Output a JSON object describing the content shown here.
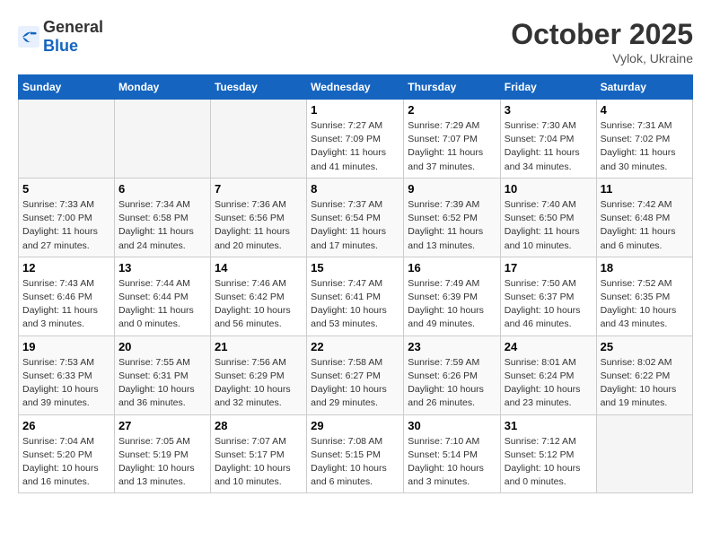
{
  "header": {
    "logo_general": "General",
    "logo_blue": "Blue",
    "month_year": "October 2025",
    "location": "Vylok, Ukraine"
  },
  "days_of_week": [
    "Sunday",
    "Monday",
    "Tuesday",
    "Wednesday",
    "Thursday",
    "Friday",
    "Saturday"
  ],
  "weeks": [
    [
      {
        "day": "",
        "info": ""
      },
      {
        "day": "",
        "info": ""
      },
      {
        "day": "",
        "info": ""
      },
      {
        "day": "1",
        "info": "Sunrise: 7:27 AM\nSunset: 7:09 PM\nDaylight: 11 hours and 41 minutes."
      },
      {
        "day": "2",
        "info": "Sunrise: 7:29 AM\nSunset: 7:07 PM\nDaylight: 11 hours and 37 minutes."
      },
      {
        "day": "3",
        "info": "Sunrise: 7:30 AM\nSunset: 7:04 PM\nDaylight: 11 hours and 34 minutes."
      },
      {
        "day": "4",
        "info": "Sunrise: 7:31 AM\nSunset: 7:02 PM\nDaylight: 11 hours and 30 minutes."
      }
    ],
    [
      {
        "day": "5",
        "info": "Sunrise: 7:33 AM\nSunset: 7:00 PM\nDaylight: 11 hours and 27 minutes."
      },
      {
        "day": "6",
        "info": "Sunrise: 7:34 AM\nSunset: 6:58 PM\nDaylight: 11 hours and 24 minutes."
      },
      {
        "day": "7",
        "info": "Sunrise: 7:36 AM\nSunset: 6:56 PM\nDaylight: 11 hours and 20 minutes."
      },
      {
        "day": "8",
        "info": "Sunrise: 7:37 AM\nSunset: 6:54 PM\nDaylight: 11 hours and 17 minutes."
      },
      {
        "day": "9",
        "info": "Sunrise: 7:39 AM\nSunset: 6:52 PM\nDaylight: 11 hours and 13 minutes."
      },
      {
        "day": "10",
        "info": "Sunrise: 7:40 AM\nSunset: 6:50 PM\nDaylight: 11 hours and 10 minutes."
      },
      {
        "day": "11",
        "info": "Sunrise: 7:42 AM\nSunset: 6:48 PM\nDaylight: 11 hours and 6 minutes."
      }
    ],
    [
      {
        "day": "12",
        "info": "Sunrise: 7:43 AM\nSunset: 6:46 PM\nDaylight: 11 hours and 3 minutes."
      },
      {
        "day": "13",
        "info": "Sunrise: 7:44 AM\nSunset: 6:44 PM\nDaylight: 11 hours and 0 minutes."
      },
      {
        "day": "14",
        "info": "Sunrise: 7:46 AM\nSunset: 6:42 PM\nDaylight: 10 hours and 56 minutes."
      },
      {
        "day": "15",
        "info": "Sunrise: 7:47 AM\nSunset: 6:41 PM\nDaylight: 10 hours and 53 minutes."
      },
      {
        "day": "16",
        "info": "Sunrise: 7:49 AM\nSunset: 6:39 PM\nDaylight: 10 hours and 49 minutes."
      },
      {
        "day": "17",
        "info": "Sunrise: 7:50 AM\nSunset: 6:37 PM\nDaylight: 10 hours and 46 minutes."
      },
      {
        "day": "18",
        "info": "Sunrise: 7:52 AM\nSunset: 6:35 PM\nDaylight: 10 hours and 43 minutes."
      }
    ],
    [
      {
        "day": "19",
        "info": "Sunrise: 7:53 AM\nSunset: 6:33 PM\nDaylight: 10 hours and 39 minutes."
      },
      {
        "day": "20",
        "info": "Sunrise: 7:55 AM\nSunset: 6:31 PM\nDaylight: 10 hours and 36 minutes."
      },
      {
        "day": "21",
        "info": "Sunrise: 7:56 AM\nSunset: 6:29 PM\nDaylight: 10 hours and 32 minutes."
      },
      {
        "day": "22",
        "info": "Sunrise: 7:58 AM\nSunset: 6:27 PM\nDaylight: 10 hours and 29 minutes."
      },
      {
        "day": "23",
        "info": "Sunrise: 7:59 AM\nSunset: 6:26 PM\nDaylight: 10 hours and 26 minutes."
      },
      {
        "day": "24",
        "info": "Sunrise: 8:01 AM\nSunset: 6:24 PM\nDaylight: 10 hours and 23 minutes."
      },
      {
        "day": "25",
        "info": "Sunrise: 8:02 AM\nSunset: 6:22 PM\nDaylight: 10 hours and 19 minutes."
      }
    ],
    [
      {
        "day": "26",
        "info": "Sunrise: 7:04 AM\nSunset: 5:20 PM\nDaylight: 10 hours and 16 minutes."
      },
      {
        "day": "27",
        "info": "Sunrise: 7:05 AM\nSunset: 5:19 PM\nDaylight: 10 hours and 13 minutes."
      },
      {
        "day": "28",
        "info": "Sunrise: 7:07 AM\nSunset: 5:17 PM\nDaylight: 10 hours and 10 minutes."
      },
      {
        "day": "29",
        "info": "Sunrise: 7:08 AM\nSunset: 5:15 PM\nDaylight: 10 hours and 6 minutes."
      },
      {
        "day": "30",
        "info": "Sunrise: 7:10 AM\nSunset: 5:14 PM\nDaylight: 10 hours and 3 minutes."
      },
      {
        "day": "31",
        "info": "Sunrise: 7:12 AM\nSunset: 5:12 PM\nDaylight: 10 hours and 0 minutes."
      },
      {
        "day": "",
        "info": ""
      }
    ]
  ]
}
